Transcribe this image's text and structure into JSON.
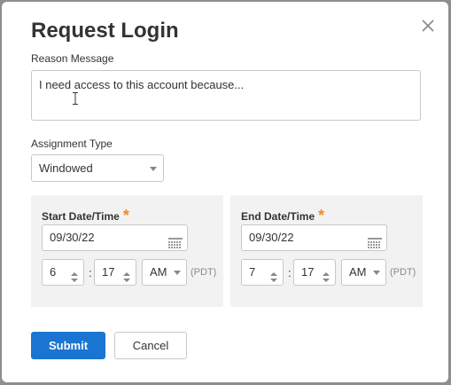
{
  "dialog": {
    "title": "Request Login",
    "close_icon": "close-icon"
  },
  "reason": {
    "label": "Reason Message",
    "value": "I need access to this account because..."
  },
  "assignment": {
    "label": "Assignment Type",
    "selected": "Windowed"
  },
  "start": {
    "label": "Start Date/Time",
    "required_mark": "*",
    "date": "09/30/22",
    "hour": "6",
    "minute": "17",
    "ampm": "AM",
    "timezone": "(PDT)"
  },
  "end": {
    "label": "End Date/Time",
    "required_mark": "*",
    "date": "09/30/22",
    "hour": "7",
    "minute": "17",
    "ampm": "AM",
    "timezone": "(PDT)"
  },
  "time_separator": ":",
  "buttons": {
    "submit": "Submit",
    "cancel": "Cancel"
  },
  "colors": {
    "primary": "#1a75d2",
    "required": "#f28b1e",
    "panel": "#f2f2f2"
  }
}
